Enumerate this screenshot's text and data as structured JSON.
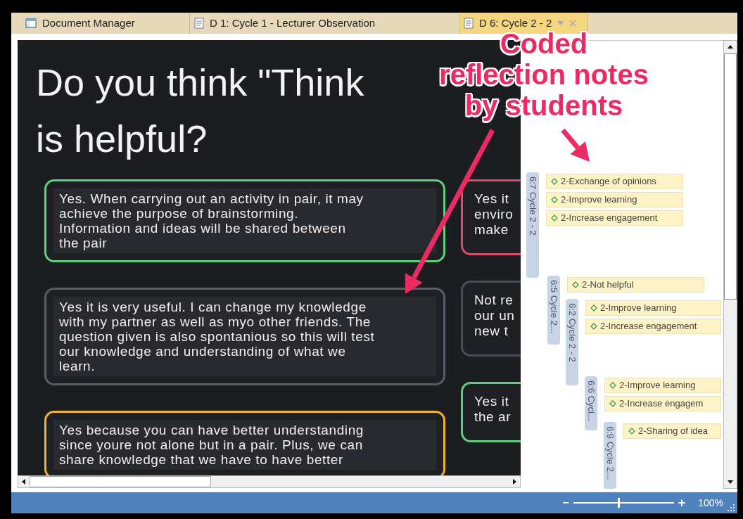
{
  "tabs": [
    {
      "label": "Document Manager",
      "kind": "manager",
      "selected": false
    },
    {
      "label": "D 1: Cycle 1 - Lecturer Observation",
      "kind": "document",
      "selected": false
    },
    {
      "label": "D 6: Cycle 2 - 2",
      "kind": "document",
      "selected": true
    }
  ],
  "slide": {
    "title_lines": [
      "Do you think \"Think",
      "is helpful?"
    ],
    "cards": [
      {
        "color": "#5fcf80",
        "lines": [
          "Yes. When carrying out an activity in pair, it may",
          "achieve the purpose of brainstorming.",
          "Information and ideas will be shared between",
          "the pair"
        ]
      },
      {
        "color": "#5a5c68",
        "lines": [
          "Yes it is very useful. I can change my knowledge",
          "with my partner as well as myo other friends. The",
          "question given is also spontanious so this will test",
          "our knowledge and understanding of what we",
          "learn."
        ]
      },
      {
        "color": "#f0b429",
        "lines": [
          "Yes because you can have better understanding",
          "since youre not alone but in a pair. Plus, we can",
          "share knowledge that we have to have better"
        ]
      }
    ],
    "side_cards": [
      {
        "color": "#d94c6a",
        "lines": [
          "Yes it",
          "enviro",
          "make"
        ]
      },
      {
        "color": "#4a4c5a",
        "lines": [
          "Not re",
          "our un",
          "new t"
        ]
      },
      {
        "color": "#5fcf80",
        "lines": [
          "Yes it",
          "the ar"
        ]
      }
    ]
  },
  "annotation": {
    "lines": [
      "Coded",
      "reflection notes",
      "by students"
    ]
  },
  "segments": [
    {
      "label": "6:7 Cycle 2 - 2",
      "codes": [
        "2-Exchange of opinions",
        "2-Improve learning",
        "2-Increase engagement"
      ]
    },
    {
      "label": "6:5 Cycle 2...",
      "codes": [
        "2-Not helpful"
      ]
    },
    {
      "label": "6:2 Cycle 2 - 2",
      "codes": [
        "2-Improve learning",
        "2-Increase engagement"
      ]
    },
    {
      "label": "6:6 Cycl...",
      "codes": [
        "2-Improve learning",
        "2-Increase engagem"
      ]
    },
    {
      "label": "6:9 Cycle 2...",
      "codes": [
        "2-Sharing of idea"
      ]
    }
  ],
  "zoom": {
    "minus": "−",
    "plus": "+",
    "level": 0.45,
    "reading": "100%"
  }
}
